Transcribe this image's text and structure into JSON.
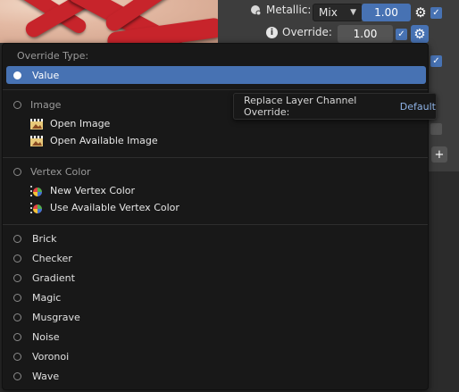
{
  "properties": {
    "metallic_label": "Metallic:",
    "metallic_mode": "Mix",
    "metallic_value": "1.00",
    "override_label": "Override:",
    "override_value": "1.00",
    "plus_glyph": "+"
  },
  "menu": {
    "title": "Override Type:",
    "value_item": "Value",
    "image_header": "Image",
    "open_image": "Open Image",
    "open_available_image": "Open Available Image",
    "vertex_color_header": "Vertex Color",
    "new_vertex_color": "New Vertex Color",
    "use_available_vertex_color": "Use Available Vertex Color",
    "textures": [
      "Brick",
      "Checker",
      "Gradient",
      "Magic",
      "Musgrave",
      "Noise",
      "Voronoi",
      "Wave"
    ]
  },
  "tooltip": {
    "label": "Replace Layer Channel Override:",
    "value": "Default"
  },
  "colors": {
    "accent": "#4772b3",
    "menu_bg": "#181818",
    "panel_bg": "#3d3d3d"
  }
}
